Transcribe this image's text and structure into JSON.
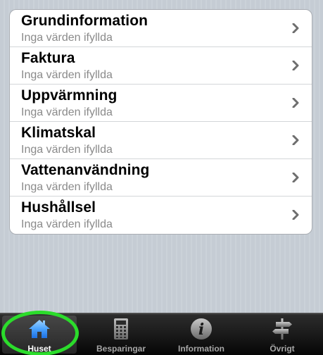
{
  "list": {
    "items": [
      {
        "title": "Grundinformation",
        "subtitle": "Inga värden ifyllda"
      },
      {
        "title": "Faktura",
        "subtitle": "Inga värden ifyllda"
      },
      {
        "title": "Uppvärmning",
        "subtitle": "Inga värden ifyllda"
      },
      {
        "title": "Klimatskal",
        "subtitle": "Inga värden ifyllda"
      },
      {
        "title": "Vattenanvändning",
        "subtitle": "Inga värden ifyllda"
      },
      {
        "title": "Hushållsel",
        "subtitle": "Inga värden ifyllda"
      }
    ]
  },
  "tabbar": {
    "tabs": [
      {
        "label": "Huset",
        "icon": "house-icon",
        "selected": true
      },
      {
        "label": "Besparingar",
        "icon": "calculator-icon",
        "selected": false
      },
      {
        "label": "Information",
        "icon": "info-icon",
        "selected": false
      },
      {
        "label": "Övrigt",
        "icon": "signpost-icon",
        "selected": false
      }
    ]
  },
  "colors": {
    "background": "#c5ccd4",
    "selected_icon": "#4aa3ff",
    "highlight_ring": "#2bdc2b"
  }
}
